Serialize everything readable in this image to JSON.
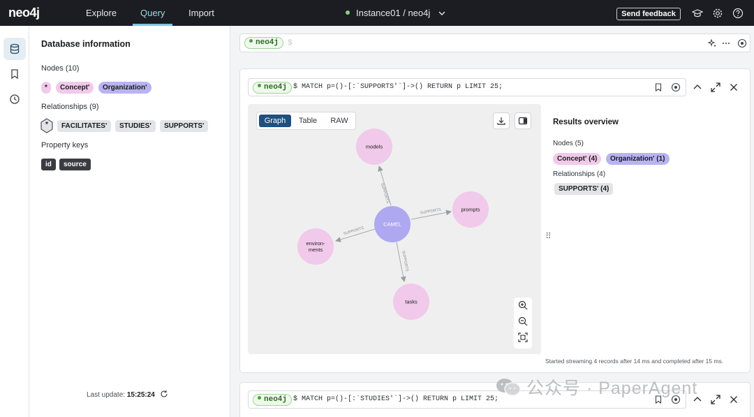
{
  "topbar": {
    "logo": "neo4j",
    "tabs": [
      {
        "label": "Explore"
      },
      {
        "label": "Query"
      },
      {
        "label": "Import"
      }
    ],
    "instance": "Instance01 / neo4j",
    "feedback": "Send feedback"
  },
  "db_panel": {
    "title": "Database information",
    "nodes_label": "Nodes (10)",
    "node_chips": [
      "*",
      "Concept'",
      "Organization'"
    ],
    "relationships_label": "Relationships (9)",
    "rel_chips": [
      "*",
      "FACILITATES'",
      "STUDIES'",
      "SUPPORTS'"
    ],
    "property_keys_label": "Property keys",
    "property_keys": [
      "id",
      "source"
    ],
    "last_update_label": "Last update:",
    "last_update_time": "15:25:24"
  },
  "editor": {
    "db": "neo4j",
    "prompt": "$"
  },
  "card1": {
    "db": "neo4j",
    "query": "$ MATCH p=()-[:`SUPPORTS'`]->() RETURN p LIMIT 25;",
    "view_tabs": [
      "Graph",
      "Table",
      "RAW"
    ],
    "graph": {
      "nodes": [
        "models",
        "prompts",
        "CAMEL",
        "environ-\nments",
        "tasks"
      ],
      "edge_label": "SUPPORTS"
    },
    "overview": {
      "title": "Results overview",
      "nodes_label": "Nodes (5)",
      "node_chips": [
        "Concept' (4)",
        "Organization' (1)"
      ],
      "relationships_label": "Relationships (4)",
      "rel_chips": [
        "SUPPORTS' (4)"
      ]
    },
    "status": "Started streaming 4 records after 14 ms and completed after 15 ms."
  },
  "card2": {
    "db": "neo4j",
    "query": "$ MATCH p=()-[:`STUDIES'`]->() RETURN p LIMIT 25;"
  },
  "watermark": "公众号 · PaperAgent",
  "colors": {
    "topbar": "#1b1d22",
    "concept": "#f1c9ea",
    "organization": "#b9b3f2",
    "accent": "#1f4f7e"
  }
}
